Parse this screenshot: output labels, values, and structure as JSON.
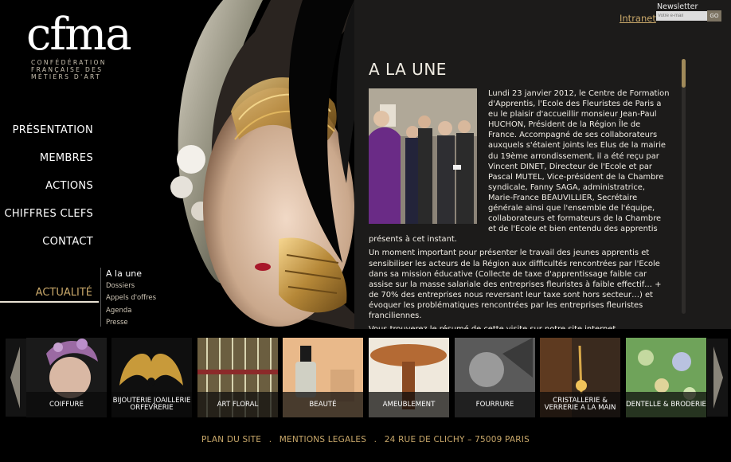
{
  "brand": {
    "logo_text": "cfma",
    "tagline": "CONFÉDÉRATION FRANÇAISE DES MÉTIERS D'ART"
  },
  "header": {
    "intranet": "Intranet",
    "newsletter_label": "Newsletter",
    "newsletter_placeholder": "Votre e-mail",
    "newsletter_go": "GO"
  },
  "nav": {
    "items": [
      {
        "label": "PRÉSENTATION"
      },
      {
        "label": "MEMBRES"
      },
      {
        "label": "ACTIONS"
      },
      {
        "label": "CHIFFRES CLEFS"
      },
      {
        "label": "CONTACT"
      }
    ],
    "active": "ACTUALITÉ",
    "sub": [
      "A la une",
      "Dossiers",
      "Appels d'offres",
      "Agenda",
      "Presse"
    ]
  },
  "article": {
    "title": "A LA UNE",
    "p1": "Lundi 23 janvier 2012, le Centre de Formation d'Apprentis, l'Ecole des Fleuristes de Paris a eu le plaisir d'accueillir monsieur Jean-Paul HUCHON, Président de la Région Île de France. Accompagné de ses collaborateurs auxquels s'étaient joints les Elus de la mairie du 19ème arrondissement, il a été reçu par Vincent DINET, Directeur de l'Ecole et par Pascal MUTEL, Vice-président de la Chambre syndicale, Fanny SAGA, administratrice, Marie-France BEAUVILLIER, Secrétaire générale ainsi que l'ensemble de l'équipe, collaborateurs et formateurs de la Chambre et de l'Ecole et bien entendu des apprentis présents à cet instant.",
    "p2": "Un moment important pour présenter le travail des jeunes apprentis et sensibiliser les acteurs de la Région aux difficultés rencontrées par l'Ecole dans sa mission éducative (Collecte de taxe d'apprentissage faible car assise sur la masse salariale des entreprises fleuristes à faible effectif… + de 70% des entreprises nous reversant leur taxe sont hors secteur…) et évoquer les problématiques rencontrées par les entreprises fleuristes franciliennes.",
    "p3": "Vous trouverez le résumé de cette visite sur notre site internet"
  },
  "carousel": {
    "items": [
      {
        "label": "COIFFURE"
      },
      {
        "label": "BIJOUTERIE JOAILLERIE ORFEVRERIE"
      },
      {
        "label": "ART FLORAL"
      },
      {
        "label": "BEAUTÉ"
      },
      {
        "label": "AMEUBLEMENT"
      },
      {
        "label": "FOURRURE"
      },
      {
        "label": "CRISTALLERIE & VERRERIE A LA MAIN"
      },
      {
        "label": "DENTELLE & BRODERIE"
      }
    ]
  },
  "footer": {
    "sitemap": "PLAN DU SITE",
    "legal": "MENTIONS LEGALES",
    "address": "24 RUE DE CLICHY – 75009 PARIS",
    "separator": "."
  },
  "colors": {
    "accent": "#c9a86a",
    "panel": "#1c1b1a"
  }
}
